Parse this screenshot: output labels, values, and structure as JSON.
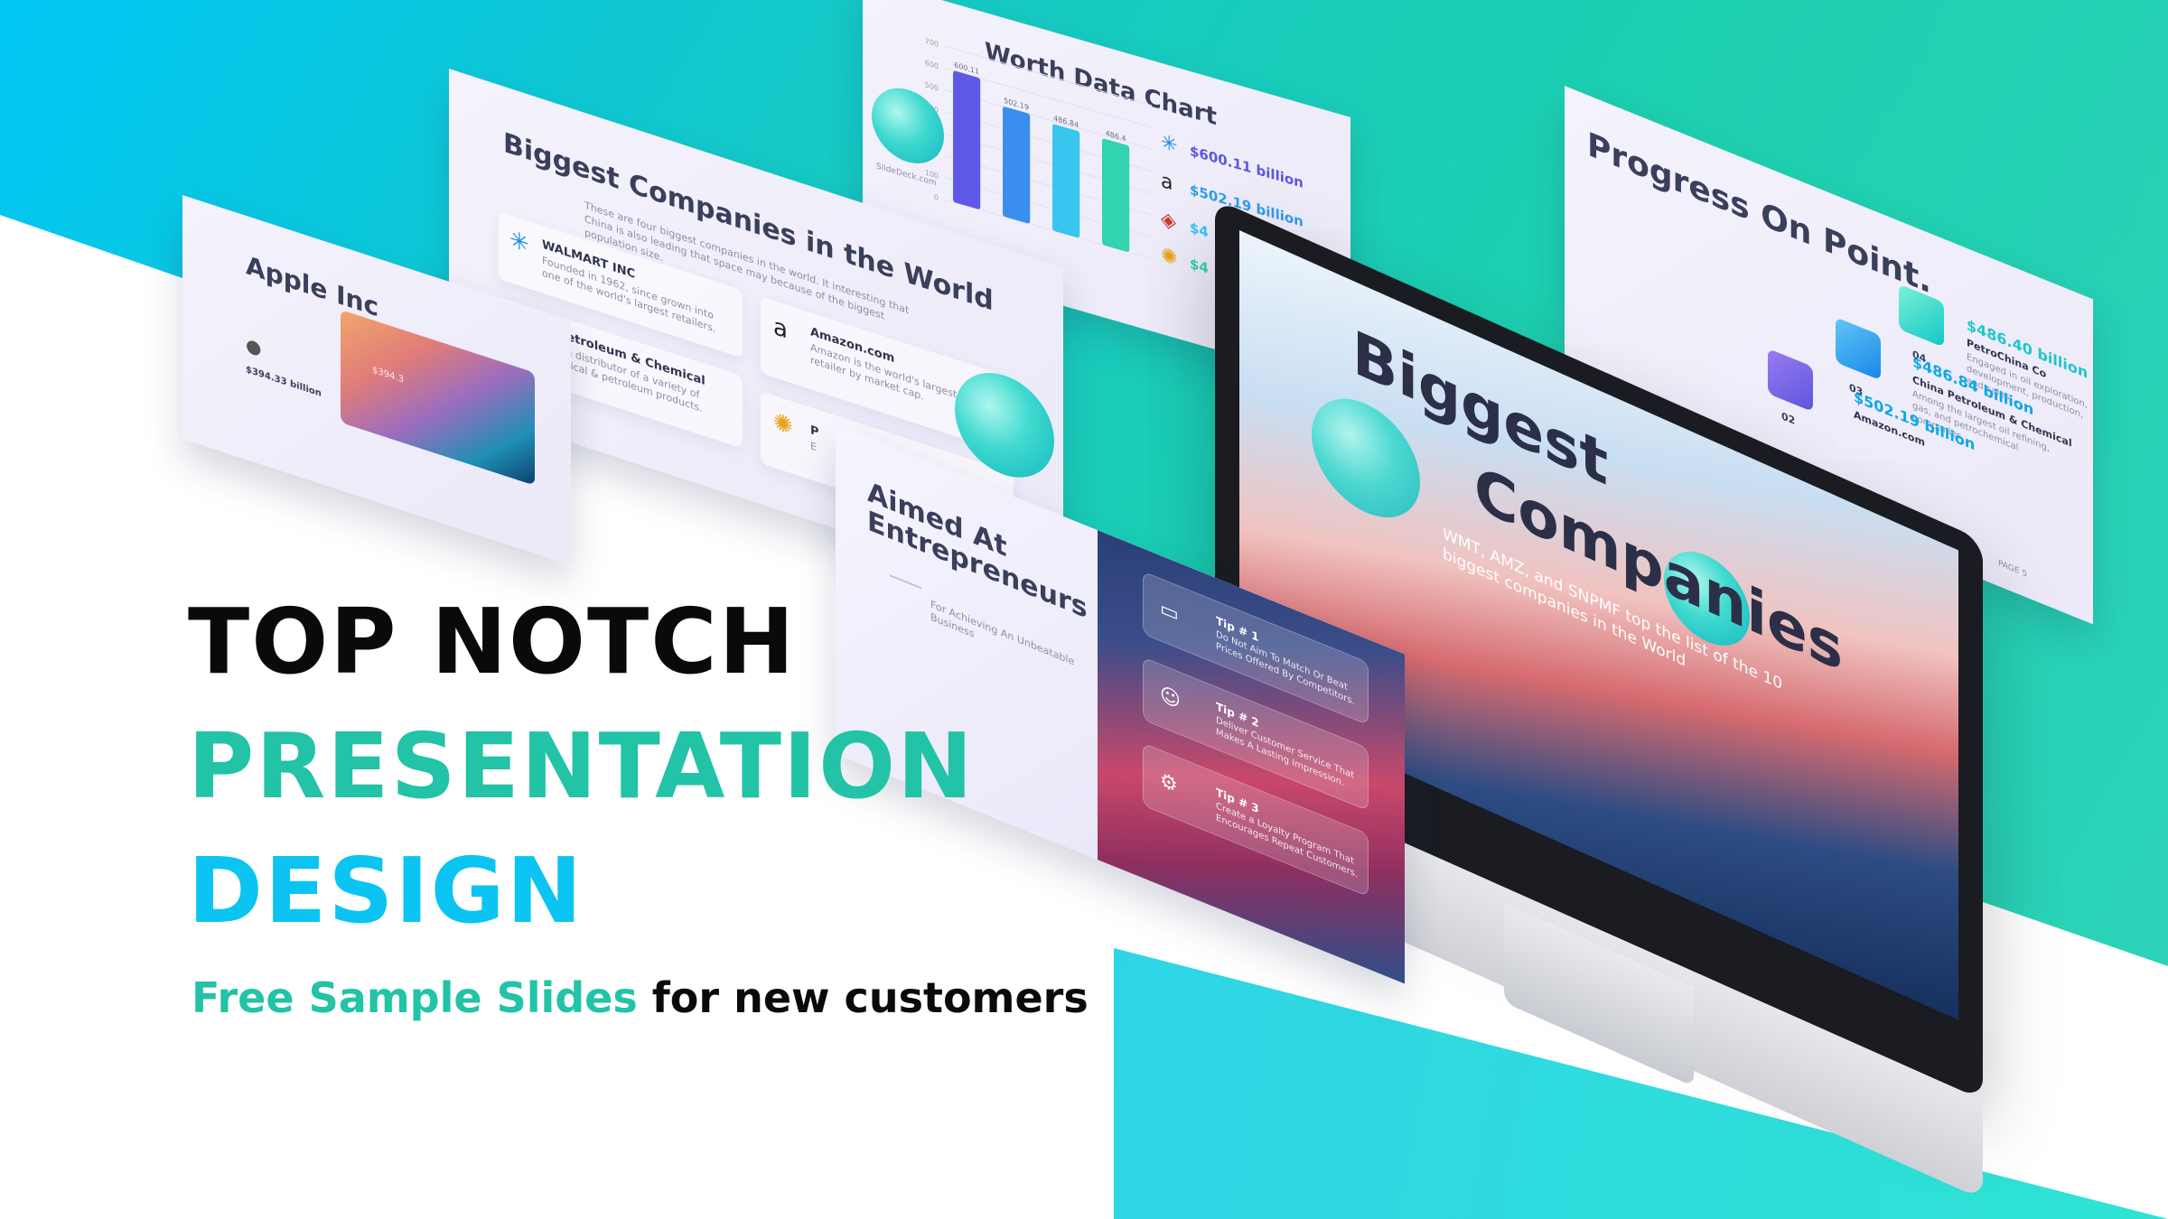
{
  "headline": {
    "line1": "TOP NOTCH",
    "line2": "PRESENTATION",
    "line3": "DESIGN",
    "tagline_accent": "Free Sample Slides",
    "tagline_rest": " for new customers",
    "colors": {
      "black": "#0a0a0a",
      "teal": "#22c3a6",
      "cyan": "#0bc4f2"
    }
  },
  "slides": {
    "apple": {
      "title": "Apple Inc",
      "logo_icon": "apple-icon",
      "amount": "$394.33 billion",
      "wave_label": "$394.3"
    },
    "biggest": {
      "title": "Biggest Companies in the World",
      "subtitle": "These are four biggest companies in the world. It interesting that China is also leading that space may because of the biggest population size.",
      "companies": [
        {
          "name": "WALMART INC",
          "desc": "Founded in 1962, since grown into one of the world's largest retailers.",
          "icon": "walmart-spark-icon"
        },
        {
          "name": "China Petroleum & Chemical",
          "desc": "producer & distributor of a variety of petrochemical & petroleum products.",
          "icon": "sinopec-icon"
        },
        {
          "name": "Amazon.com",
          "desc": "Amazon is the world's largest online retailer by market cap.",
          "icon": "amazon-icon"
        },
        {
          "name": "P",
          "desc": "E",
          "icon": "petrochina-icon"
        }
      ]
    },
    "chart": {
      "title": "Worth Data Chart",
      "legend": [
        {
          "icon": "walmart-spark-icon",
          "value": "$600.11 billion"
        },
        {
          "icon": "amazon-icon",
          "value": "$502.19 billion"
        },
        {
          "icon": "sinopec-icon",
          "value": "$4"
        },
        {
          "icon": "petrochina-icon",
          "value": "$4"
        }
      ],
      "footnote": "SlideDeck.com"
    },
    "progress": {
      "title": "Progress On Point.",
      "items": [
        {
          "num": "04",
          "value": "$486.40 billion",
          "label": "PetroChina Co",
          "desc": "Engaged in oil exploration, development, production, and sales"
        },
        {
          "num": "03",
          "value": "$486.84 billion",
          "label": "China Petroleum & Chemical",
          "desc": "Among the largest oil refining, gas, and petrochemical companies"
        },
        {
          "num": "02",
          "value": "$502.19 billion",
          "label": "Amazon.com",
          "desc": ""
        }
      ],
      "page": "PAGE 5"
    },
    "aimed": {
      "title": "Aimed At Entrepreneurs",
      "tagline": "For Achieving An Unbeatable Business",
      "tips": [
        {
          "title": "Tip # 1",
          "text": "Do Not Aim To Match Or Beat Prices Offered By Competitors.",
          "icon": "money-icon"
        },
        {
          "title": "Tip # 2",
          "text": "Deliver Customer Service That Makes A Lasting Impression.",
          "icon": "team-icon"
        },
        {
          "title": "Tip # 3",
          "text": "Create a Loyalty Program That Encourages Repeat Customers.",
          "icon": "loyalty-icon"
        }
      ]
    },
    "monitor": {
      "title1": "Biggest",
      "title2": "Companies",
      "subtitle": "WMT, AMZ, and SNPMF top the list of the 10 biggest companies in the World"
    }
  },
  "chart_data": {
    "type": "bar",
    "categories": [
      "Walmart",
      "Amazon",
      "China Petroleum & Chemical",
      "PetroChina"
    ],
    "values": [
      600.11,
      502.19,
      486.84,
      486.4
    ],
    "bar_labels": [
      "600.11",
      "502.19",
      "486.84",
      "486.4"
    ],
    "title": "Worth Data Chart",
    "ylim": [
      0,
      700
    ],
    "yticks": [
      0,
      100,
      200,
      300,
      400,
      500,
      600,
      700
    ],
    "colors": [
      "#5f58e6",
      "#3a8ef0",
      "#36c6ee",
      "#31d3b0"
    ]
  }
}
